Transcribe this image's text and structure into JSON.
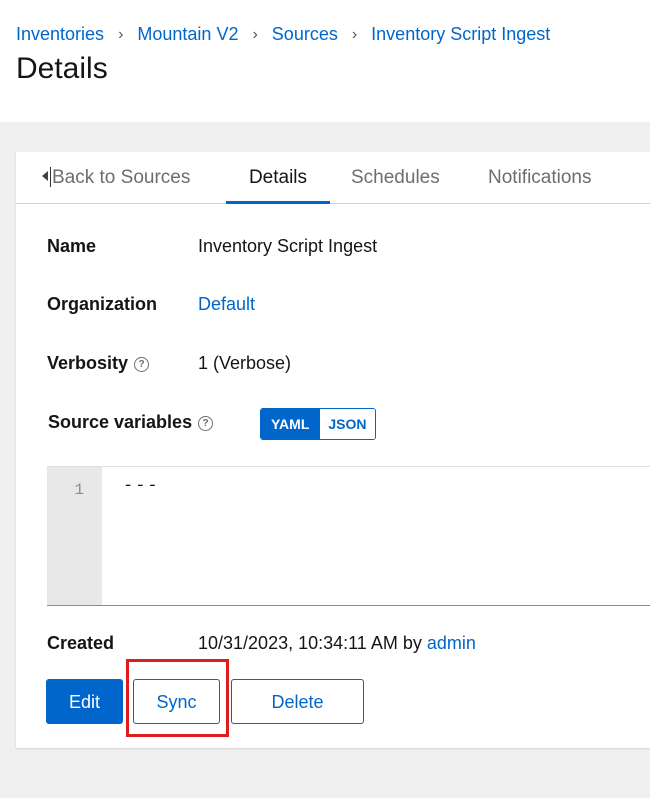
{
  "breadcrumb": {
    "items": [
      "Inventories",
      "Mountain V2",
      "Sources",
      "Inventory Script Ingest"
    ]
  },
  "page": {
    "title": "Details"
  },
  "tabs": {
    "back": "Back to Sources",
    "details": "Details",
    "schedules": "Schedules",
    "notifications": "Notifications",
    "active": "Details"
  },
  "details": {
    "name_label": "Name",
    "name_value": "Inventory Script Ingest",
    "organization_label": "Organization",
    "organization_value": "Default",
    "verbosity_label": "Verbosity",
    "verbosity_value": "1 (Verbose)",
    "source_variables_label": "Source variables",
    "created_label": "Created",
    "created_value": "10/31/2023, 10:34:11 AM by",
    "created_by": "admin"
  },
  "format_toggle": {
    "yaml": "YAML",
    "json": "JSON",
    "selected": "YAML"
  },
  "editor": {
    "line_number": "1",
    "code": "---"
  },
  "actions": {
    "edit": "Edit",
    "sync": "Sync",
    "delete": "Delete"
  },
  "icons": {
    "help": "help-circle-icon",
    "back": "caret-left-icon",
    "breadcrumb_separator": "chevron-right-icon"
  },
  "colors": {
    "primary": "#0066cc",
    "highlight": "#e01b1b",
    "background": "#f0f0f0"
  }
}
